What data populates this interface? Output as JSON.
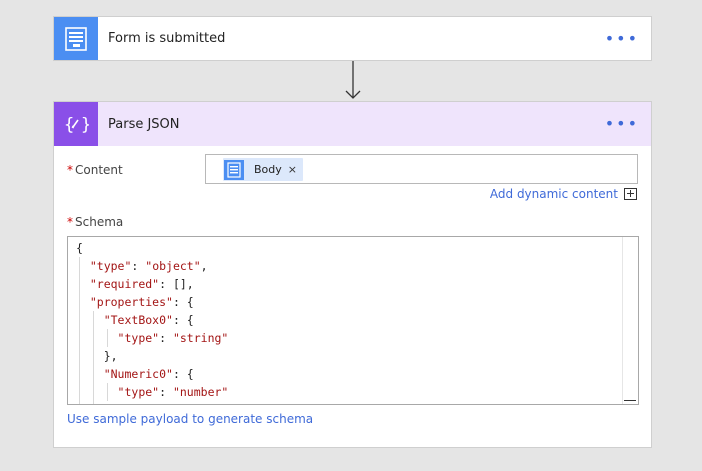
{
  "trigger": {
    "title": "Form is submitted",
    "more_label": "•••",
    "accent_color": "#4b8ef2"
  },
  "action": {
    "title": "Parse JSON",
    "more_label": "•••",
    "accent_color": "#8a4fe8",
    "header_bg": "#efe4fc"
  },
  "content_field": {
    "required_mark": "*",
    "label": "Content",
    "token_label": "Body",
    "token_remove": "×"
  },
  "add_dynamic_content": "Add dynamic content",
  "schema_field": {
    "required_mark": "*",
    "label": "Schema",
    "lines": [
      "{",
      "  \"type\": \"object\",",
      "  \"required\": [],",
      "  \"properties\": {",
      "    \"TextBox0\": {",
      "      \"type\": \"string\"",
      "    },",
      "    \"Numeric0\": {",
      "      \"type\": \"number\"",
      "    }"
    ]
  },
  "sample_payload_link": "Use sample payload to generate schema"
}
